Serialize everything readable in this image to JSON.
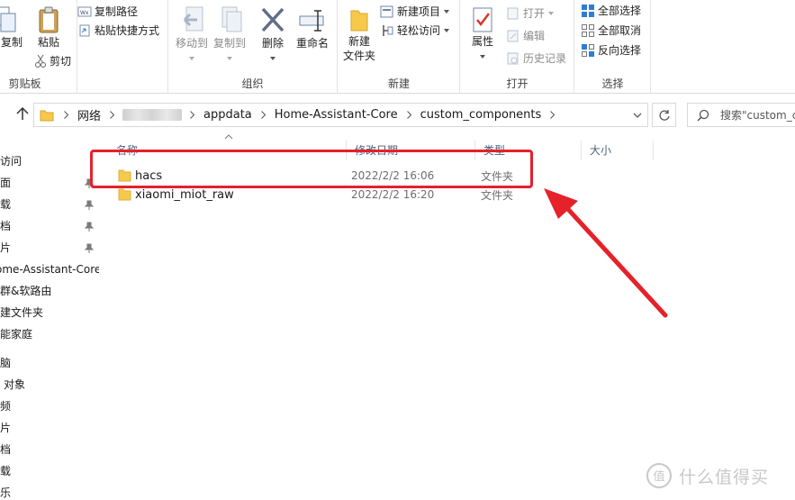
{
  "ribbon": {
    "clipboard": {
      "copy_label": "复制",
      "paste_label": "粘贴",
      "copy_path_label": "复制路径",
      "paste_shortcut_label": "粘贴快捷方式",
      "cut_label": "剪切",
      "group_label": "剪贴板"
    },
    "organize": {
      "move_to_label": "移动到",
      "copy_to_label": "复制到",
      "delete_label": "删除",
      "rename_label": "重命名",
      "group_label": "组织"
    },
    "new": {
      "new_folder_label_1": "新建",
      "new_folder_label_2": "文件夹",
      "new_item_label": "新建项目",
      "easy_access_label": "轻松访问",
      "group_label": "新建"
    },
    "open": {
      "properties_label": "属性",
      "open_label": "打开",
      "edit_label": "编辑",
      "history_label": "历史记录",
      "group_label": "打开"
    },
    "select": {
      "select_all_label": "全部选择",
      "select_none_label": "全部取消",
      "invert_label": "反向选择",
      "group_label": "选择"
    }
  },
  "address": {
    "crumbs": [
      "网络",
      "appdata",
      "Home-Assistant-Core",
      "custom_components"
    ],
    "search_placeholder": "搜索\"custom_c"
  },
  "nav": {
    "items": [
      "访问",
      "面",
      "载",
      "档",
      "片",
      "ome-Assistant-Core",
      "群&软路由",
      "建文件夹",
      "能家庭",
      "脑",
      "对象",
      "频",
      "片",
      "档",
      "载",
      "乐"
    ]
  },
  "list": {
    "columns": {
      "name": "名称",
      "date": "修改日期",
      "type": "类型",
      "size": "大小"
    },
    "rows": [
      {
        "name": "hacs",
        "date": "2022/2/2 16:06",
        "type": "文件夹"
      },
      {
        "name": "xiaomi_miot_raw",
        "date": "2022/2/2 16:20",
        "type": "文件夹"
      }
    ]
  },
  "watermark": {
    "text": "什么值得买",
    "glyph": "值"
  },
  "colors": {
    "highlight": "#e5212a",
    "folder": "#f6c94c",
    "column_header": "#4c607a",
    "accent_blue": "#2f7dd3"
  }
}
